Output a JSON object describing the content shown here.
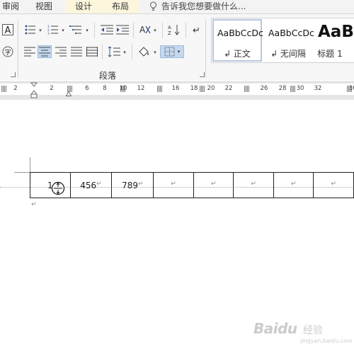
{
  "tabs": [
    {
      "label": "审阅",
      "highlighted": false
    },
    {
      "label": "视图",
      "highlighted": false
    },
    {
      "label": "设计",
      "highlighted": true
    },
    {
      "label": "布局",
      "highlighted": true
    }
  ],
  "tell_me": {
    "text": "告诉我您想要做什么...",
    "icon": "lightbulb-icon"
  },
  "ribbon": {
    "paragraph_group_label": "段落",
    "char_border_glyph": "A",
    "phonetic_glyph": "字"
  },
  "styles_gallery": [
    {
      "sample": "AaBbCcDc",
      "name": "↲ 正文",
      "selected": true
    },
    {
      "sample": "AaBbCcDc",
      "name": "↲ 无间隔",
      "selected": false
    },
    {
      "sample": "AaB",
      "name": "标题 1",
      "selected": false
    }
  ],
  "ruler": {
    "ticks": [
      "2",
      "2",
      "6",
      "8",
      "10",
      "12",
      "16",
      "18",
      "20",
      "22",
      "26",
      "28",
      "30",
      "32",
      "36"
    ]
  },
  "table": {
    "row": [
      "1",
      "456",
      "789",
      "",
      "",
      "",
      "",
      ""
    ],
    "paragraph_mark": "↵"
  },
  "after_table_mark": "↵",
  "watermark": {
    "logo": "Baidu",
    "sub": "经验",
    "url": "jingyan.baidu.com"
  },
  "colors": {
    "ribbon_bg": "#f7f7f7",
    "tab_highlight": "#fbf6dc",
    "selected_button": "#c5d9ee"
  }
}
